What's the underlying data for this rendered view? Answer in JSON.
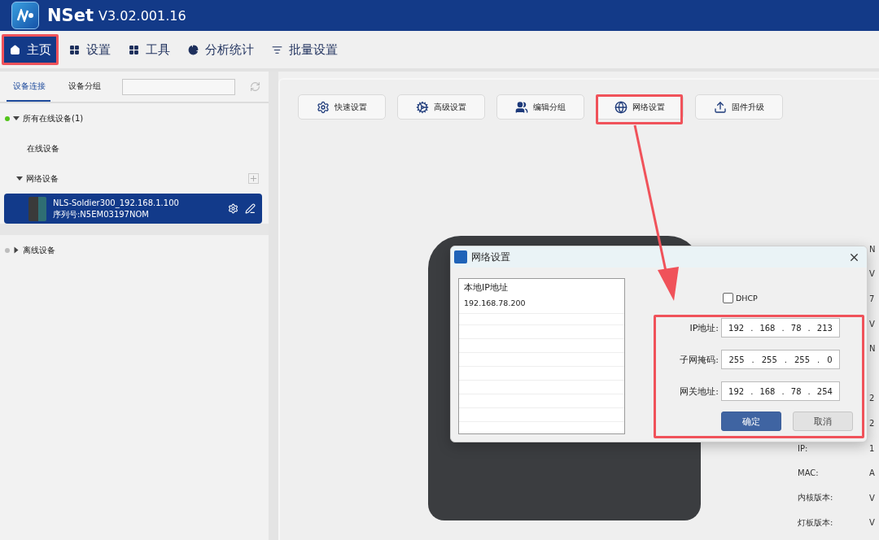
{
  "app": {
    "title": "NSet",
    "version": "V3.02.001.16"
  },
  "nav": [
    {
      "label": "主页",
      "selected": true
    },
    {
      "label": "设置",
      "selected": false
    },
    {
      "label": "工具",
      "selected": false
    },
    {
      "label": "分析统计",
      "selected": false
    },
    {
      "label": "批量设置",
      "selected": false
    }
  ],
  "sidebar": {
    "tabs": [
      {
        "label": "设备连接",
        "selected": true
      },
      {
        "label": "设备分组",
        "selected": false
      }
    ],
    "tree": [
      {
        "label": "所有在线设备(1)",
        "color": "#52c41a",
        "expanded": true,
        "children": [
          {
            "kind": "leaf",
            "label": "在线设备"
          },
          {
            "kind": "group",
            "label": "网络设备",
            "expanded": true,
            "children": [
              {
                "kind": "device",
                "name": "NLS-Soldier300_192.168.1.100",
                "serial": "序列号:N5EM03197NOM",
                "selected": true
              }
            ]
          }
        ]
      },
      {
        "label": "离线设备",
        "color": "#bdbdbd",
        "expanded": false
      }
    ]
  },
  "toolbar": [
    {
      "label": "快速设置"
    },
    {
      "label": "高级设置"
    },
    {
      "label": "编辑分组"
    },
    {
      "label": "网络设置"
    },
    {
      "label": "固件升级"
    }
  ],
  "info": [
    {
      "kind": "field",
      "value": "N"
    },
    {
      "kind": "field",
      "value": "V"
    },
    {
      "kind": "field",
      "value": "7"
    },
    {
      "kind": "field",
      "value": "V"
    },
    {
      "kind": "field",
      "value": "N"
    },
    {
      "kind": "spacer"
    },
    {
      "kind": "field",
      "value": "2"
    },
    {
      "kind": "field",
      "value": "2"
    },
    {
      "kind": "field",
      "label": "IP:",
      "value": "1"
    },
    {
      "kind": "field",
      "label": "MAC:",
      "value": "A"
    },
    {
      "kind": "field",
      "label": "内核版本:",
      "value": "V"
    },
    {
      "kind": "field",
      "label": "灯板版本:",
      "value": "V"
    }
  ],
  "dialog": {
    "title": "网络设置",
    "list": {
      "header": "本地IP地址",
      "items": [
        "192.168.78.200"
      ]
    },
    "dhcp": {
      "label": "DHCP",
      "checked": false
    },
    "separator": ".",
    "fields": [
      {
        "label": "IP地址:",
        "octets": [
          "192",
          "168",
          "78",
          "213"
        ]
      },
      {
        "label": "子网掩码:",
        "octets": [
          "255",
          "255",
          "255",
          "0"
        ]
      },
      {
        "label": "网关地址:",
        "octets": [
          "192",
          "168",
          "78",
          "254"
        ]
      }
    ],
    "buttons": [
      {
        "label": "确定",
        "kind": "primary"
      },
      {
        "label": "取消",
        "kind": "secondary"
      }
    ]
  }
}
